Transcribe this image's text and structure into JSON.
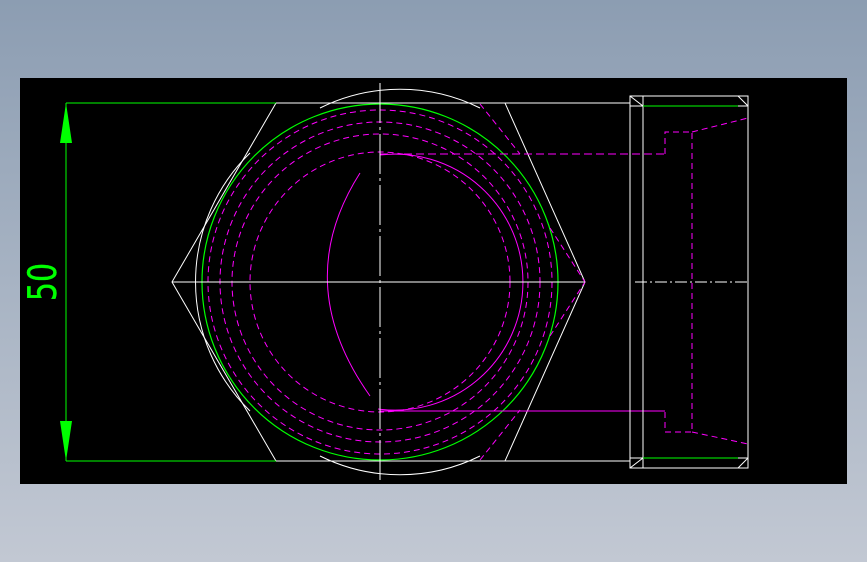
{
  "drawing": {
    "dimension_label": "50",
    "colors": {
      "background": "#000000",
      "outline": "#ffffff",
      "dimension": "#00ff00",
      "hidden_lines": "#ff00ff",
      "centerline": "#ffffff"
    }
  }
}
